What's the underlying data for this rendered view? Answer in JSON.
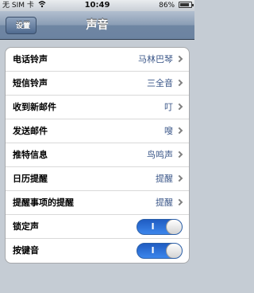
{
  "status_bar": {
    "carrier": "无 SIM 卡",
    "time": "10:49",
    "battery_text": "86%",
    "battery_level": 0.86
  },
  "nav": {
    "back_label": "设置",
    "title": "声音"
  },
  "rows": [
    {
      "label": "电话铃声",
      "value": "马林巴琴"
    },
    {
      "label": "短信铃声",
      "value": "三全音"
    },
    {
      "label": "收到新邮件",
      "value": "叮"
    },
    {
      "label": "发送邮件",
      "value": "嗖"
    },
    {
      "label": "推特信息",
      "value": "鸟鸣声"
    },
    {
      "label": "日历提醒",
      "value": "提醒"
    },
    {
      "label": "提醒事项的提醒",
      "value": "提醒"
    }
  ],
  "toggles": [
    {
      "label": "锁定声",
      "on_text": "I",
      "on": true
    },
    {
      "label": "按键音",
      "on_text": "I",
      "on": true
    }
  ]
}
